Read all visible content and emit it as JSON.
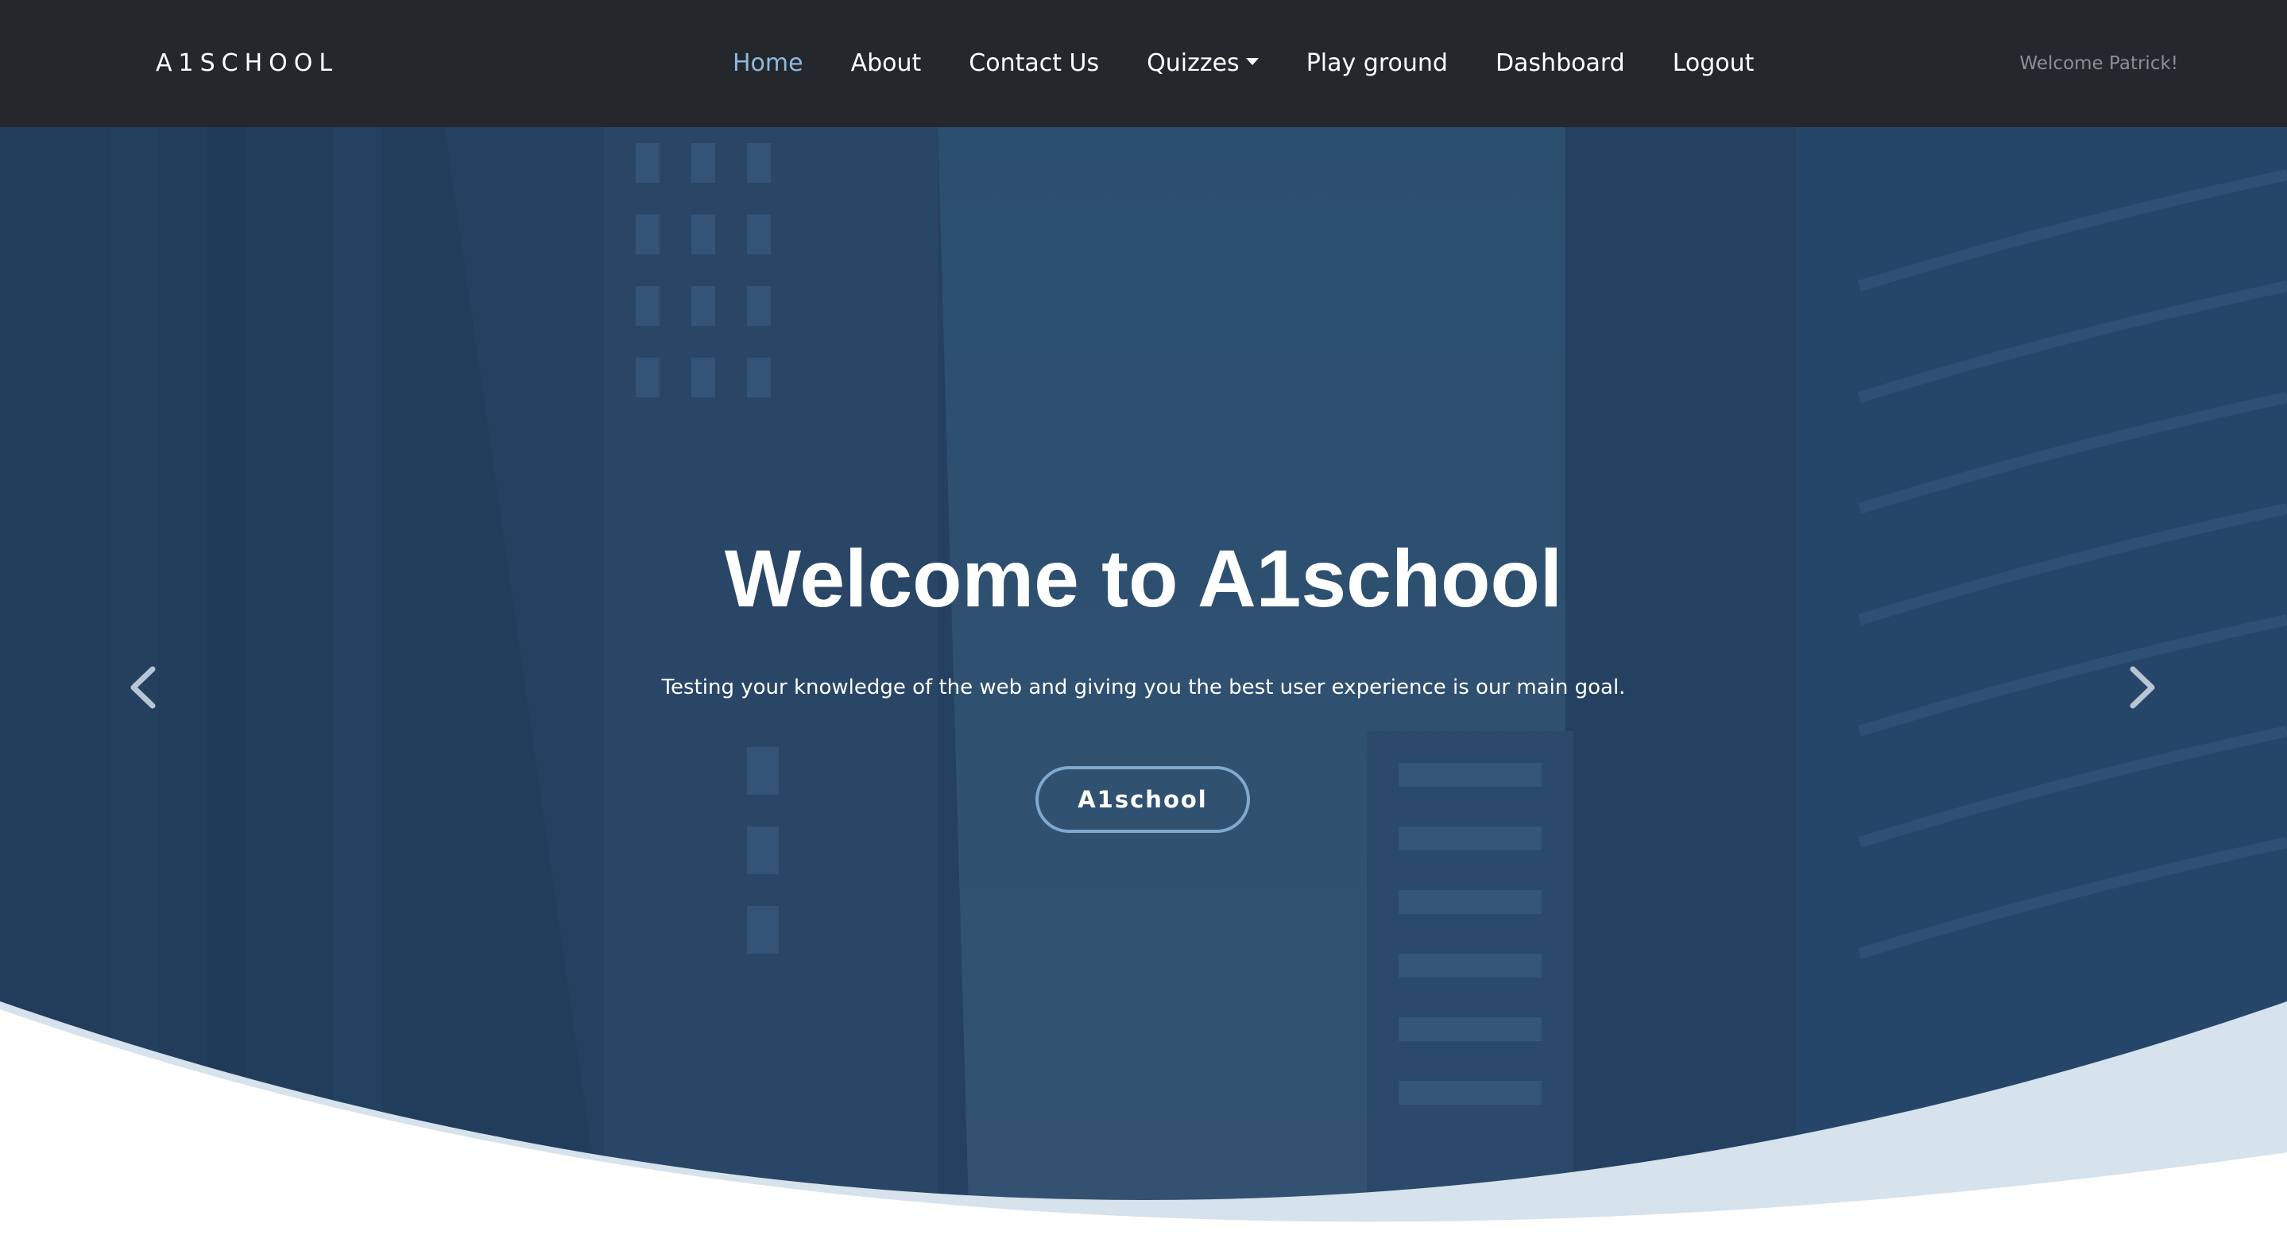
{
  "navbar": {
    "brand": "A1SCHOOL",
    "links": [
      {
        "label": "Home",
        "active": true
      },
      {
        "label": "About"
      },
      {
        "label": "Contact Us"
      },
      {
        "label": "Quizzes",
        "dropdown": true
      },
      {
        "label": "Play ground"
      },
      {
        "label": "Dashboard"
      },
      {
        "label": "Logout"
      }
    ],
    "welcome": "Welcome Patrick!"
  },
  "hero": {
    "title": "Welcome to A1school",
    "subtitle": "Testing your knowledge of the web and giving you the best user experience is our main goal.",
    "button_label": "A1school",
    "prev_icon": "chevron-left-icon",
    "next_icon": "chevron-right-icon"
  },
  "colors": {
    "navbar_bg": "#24272c",
    "active_link": "#8fb8dd",
    "hero_overlay": "#2b4a68",
    "wave_light": "#d6e2ec"
  }
}
